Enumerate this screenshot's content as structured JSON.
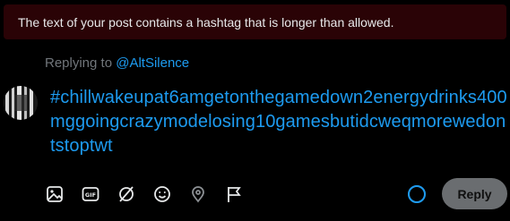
{
  "error": {
    "message": "The text of your post contains a hashtag that is longer than allowed."
  },
  "reply_context": {
    "prefix": "Replying to ",
    "handle": "@AltSilence"
  },
  "composer": {
    "text": "#chillwakeupat6amgetonthegamedown2energydrinks400mggoingcrazymodelosing10gamesbutidcweqmorewedontstoptwt"
  },
  "toolbar": {
    "icons": [
      "image-icon",
      "gif-icon",
      "grok-icon",
      "emoji-icon",
      "location-icon",
      "flag-icon"
    ]
  },
  "reply_button": {
    "label": "Reply"
  },
  "colors": {
    "accent": "#1d9bf0",
    "error_bg": "#2a0306",
    "button_disabled": "#6a6d70"
  }
}
